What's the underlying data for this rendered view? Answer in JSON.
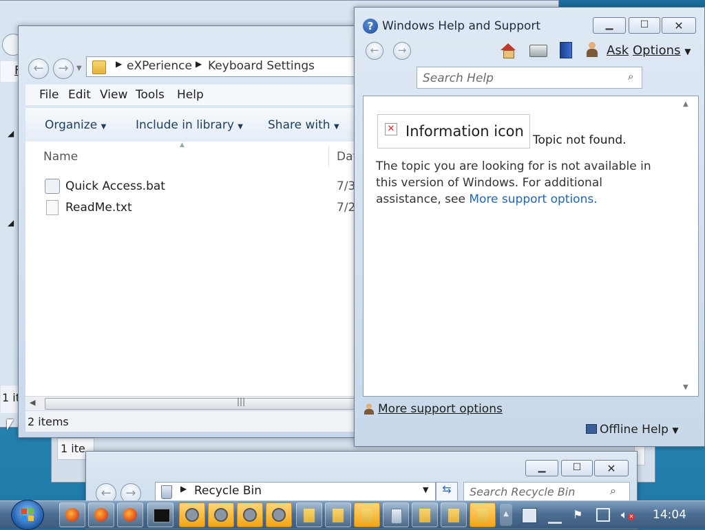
{
  "background_windows": {
    "left_status_text": "1 it",
    "small_window_status": "1 ite",
    "left_menu_letter": "F"
  },
  "explorer": {
    "breadcrumb": [
      "eXPerience",
      "Keyboard Settings"
    ],
    "menu": [
      "File",
      "Edit",
      "View",
      "Tools",
      "Help"
    ],
    "commands": [
      "Organize",
      "Include in library",
      "Share with"
    ],
    "columns": {
      "name": "Name",
      "date": "Dat"
    },
    "files": [
      {
        "name": "Quick Access.bat",
        "date": "7/3",
        "icon": "batch-file-icon"
      },
      {
        "name": "ReadMe.txt",
        "date": "7/2",
        "icon": "text-file-icon"
      }
    ],
    "status": "2 items"
  },
  "help": {
    "title": "Windows Help and Support",
    "toolbar": {
      "ask": "Ask",
      "options": "Options"
    },
    "search_placeholder": "Search Help",
    "info_icon_alt": "Information icon",
    "topic_not_found": "Topic not found.",
    "message": "The topic you are looking for is not available in this version of Windows. For additional assistance, see",
    "link": "More support options",
    "link_suffix": ".",
    "footer_link": "More support options",
    "offline_help": "Offline Help"
  },
  "recycle": {
    "address": "Recycle Bin",
    "search_placeholder": "Search Recycle Bin"
  },
  "taskbar": {
    "clock": "14:04",
    "colors": {
      "active_button": "#f3a514",
      "taskbar": "#4d6f93"
    }
  }
}
